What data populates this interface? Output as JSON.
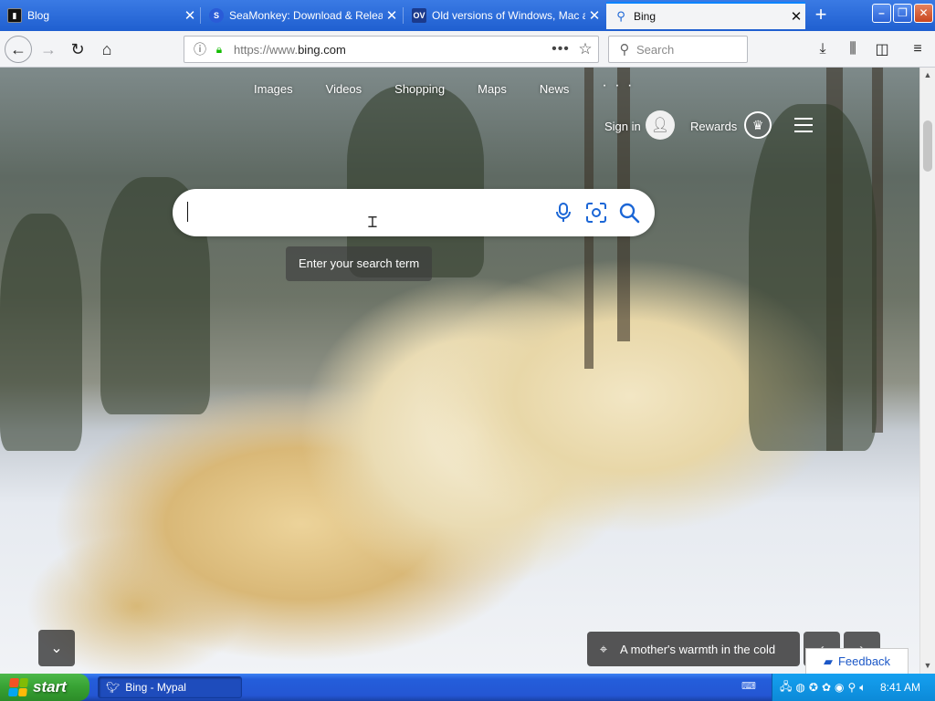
{
  "browser": {
    "tabs": [
      {
        "title": "Blog",
        "favicon": "terminal-icon",
        "active": false
      },
      {
        "title": "SeaMonkey: Download & Release",
        "favicon": "seamonkey-icon",
        "active": false
      },
      {
        "title": "Old versions of Windows, Mac an",
        "favicon": "ov-icon",
        "favicon_text": "OV",
        "active": false
      },
      {
        "title": "Bing",
        "favicon": "search-icon",
        "active": true
      }
    ],
    "close_glyph": "✕",
    "new_tab_glyph": "+",
    "window_controls": {
      "minimize": "–",
      "restore": "❐",
      "close": "✕"
    },
    "url": {
      "scheme": "https://www.",
      "host": "bing.com"
    },
    "more_glyph": "•••",
    "search_placeholder": "Search"
  },
  "bing": {
    "nav": [
      "Images",
      "Videos",
      "Shopping",
      "Maps",
      "News"
    ],
    "nav_more": "· · ·",
    "sign_in": "Sign in",
    "rewards": "Rewards",
    "search_value": "",
    "tooltip": "Enter your search term",
    "caption": "A mother's warmth in the cold",
    "feedback": "Feedback",
    "prev_glyph": "‹",
    "next_glyph": "›"
  },
  "taskbar": {
    "start": "start",
    "task": "Bing - Mypal",
    "clock": "8:41 AM"
  },
  "colors": {
    "accent": "#0a84ff",
    "bing_blue": "#1b66d6",
    "lock_green": "#12bc00",
    "taskbar_blue": "#245edb",
    "start_green": "#37a133"
  }
}
